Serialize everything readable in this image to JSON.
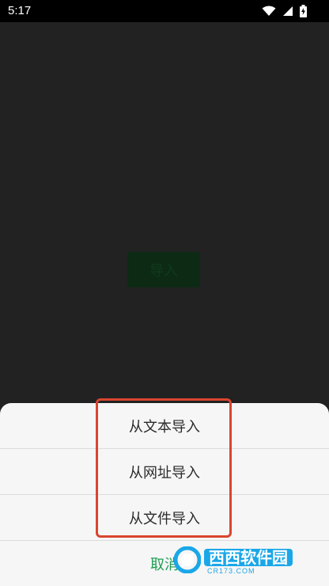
{
  "status_bar": {
    "time": "5:17",
    "icons": [
      "wifi-icon",
      "cell-signal-icon",
      "battery-charging-icon"
    ]
  },
  "main": {
    "import_button_label": "导入"
  },
  "sheet": {
    "options": [
      {
        "label": "从文本导入"
      },
      {
        "label": "从网址导入"
      },
      {
        "label": "从文件导入"
      }
    ],
    "cancel_label": "取消"
  },
  "colors": {
    "sheet_background": "#f6f6f6",
    "cancel_text": "#1e9e53",
    "highlight_border": "#d9452f",
    "screen_background": "#222222"
  },
  "watermark": {
    "logo": "cr173-logo-icon",
    "text": "西西软件园",
    "subtext": "CR173.COM"
  }
}
